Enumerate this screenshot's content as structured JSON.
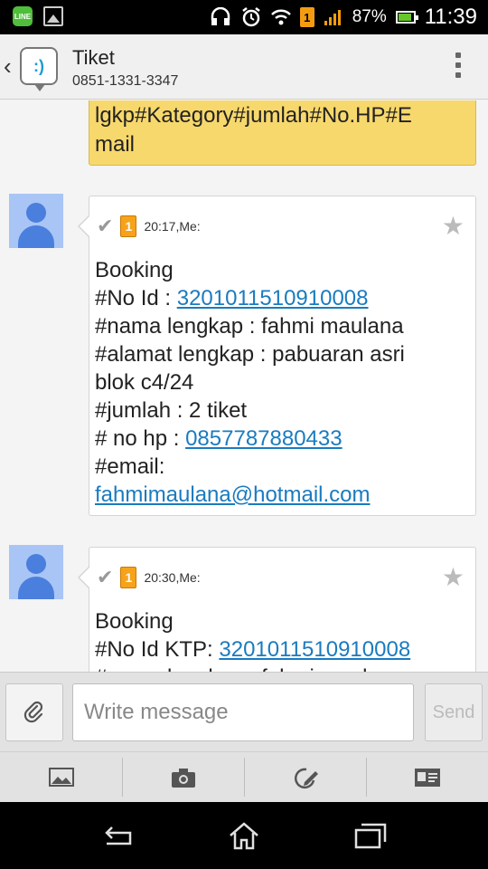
{
  "status_bar": {
    "left_icons": [
      "line-app-icon",
      "gallery-icon"
    ],
    "battery": "87%",
    "time": "11:39",
    "sim_indicator": "1",
    "line_icon_label": "LINE"
  },
  "header": {
    "title": "Tiket",
    "subtitle": "0851-1331-3347",
    "app_icon_glyph": ":)"
  },
  "conversation": {
    "previous_sent": "lgkp#Kategory#jumlah#No.HP#E\nmail",
    "messages": [
      {
        "sim": "1",
        "time": "20:17,Me:",
        "lines": [
          {
            "text": "Booking"
          },
          {
            "prefix": "#No Id : ",
            "link": "3201011510910008"
          },
          {
            "text": "#nama lengkap : fahmi maulana"
          },
          {
            "text": "#alamat lengkap : pabuaran asri"
          },
          {
            "text": "blok c4/24"
          },
          {
            "text": "#jumlah : 2 tiket"
          },
          {
            "prefix": "# no hp : ",
            "link": "0857787880433"
          },
          {
            "text": "#email:"
          },
          {
            "link": "fahmimaulana@hotmail.com"
          }
        ]
      },
      {
        "sim": "1",
        "time": "20:30,Me:",
        "lines": [
          {
            "text": "Booking"
          },
          {
            "prefix": "#No Id KTP: ",
            "link": "3201011510910008"
          },
          {
            "text": "#nama lengkap : fahmi maulana"
          }
        ]
      }
    ]
  },
  "composer": {
    "placeholder": "Write message",
    "send_label": "Send"
  },
  "toolbar": {
    "tools": [
      "gallery-icon",
      "camera-icon",
      "sketch-icon",
      "contact-card-icon"
    ]
  },
  "navbar": {
    "buttons": [
      "back-icon",
      "home-icon",
      "recent-apps-icon"
    ]
  },
  "colors": {
    "sent_bubble": "#f7d86c",
    "link": "#1a7bbf",
    "avatar_bg": "#a9c5f6",
    "avatar_fg": "#4a7fdd",
    "sim_badge": "#f7a21a"
  }
}
